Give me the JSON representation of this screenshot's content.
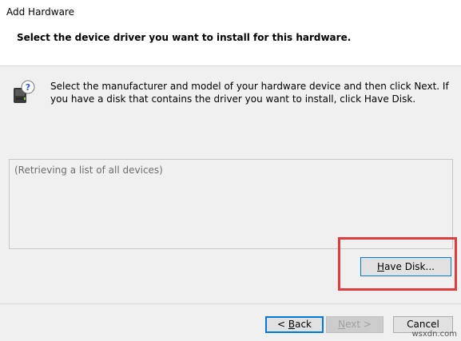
{
  "window": {
    "title": "Add Hardware"
  },
  "header": {
    "heading": "Select the device driver you want to install for this hardware."
  },
  "instruction": {
    "text": "Select the manufacturer and model of your hardware device and then click Next. If you have a disk that contains the driver you want to install, click Have Disk.",
    "icon": "hardware-help-icon"
  },
  "device_list": {
    "status_text": "(Retrieving a list of all devices)"
  },
  "buttons": {
    "have_disk": {
      "prefix": "",
      "mnemonic": "H",
      "suffix": "ave Disk..."
    },
    "back": {
      "prefix": "< ",
      "mnemonic": "B",
      "suffix": "ack"
    },
    "next": {
      "prefix": "",
      "mnemonic": "N",
      "suffix": "ext >"
    },
    "cancel": {
      "label": "Cancel"
    }
  },
  "watermark": "wsxdn.com",
  "colors": {
    "highlight": "#e03c3c",
    "focus_border": "#0078d7",
    "dialog_bg": "#f0f0f0",
    "header_bg": "#ffffff"
  }
}
